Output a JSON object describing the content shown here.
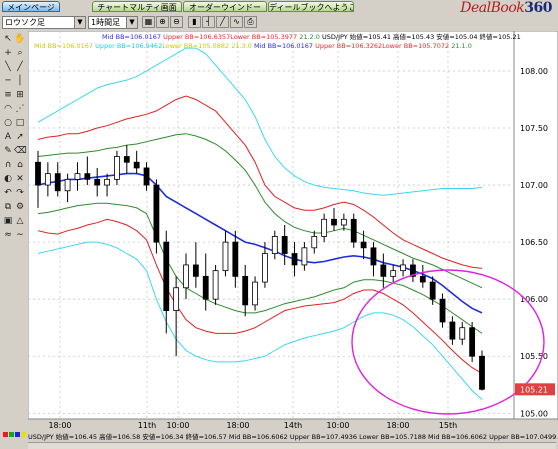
{
  "tabs": [
    {
      "label": "メインページ"
    },
    {
      "label": "チャートマルティ画面"
    },
    {
      "label": "オーダーウインドー"
    },
    {
      "label": "ディールブックへようこそ"
    }
  ],
  "logo": {
    "text": "DealBook",
    "num": "360"
  },
  "toolbar": {
    "chart_type": "ロウソク足",
    "timeframe": "1時間足"
  },
  "legend": {
    "line1": {
      "mid": "Mid BB=106.0167",
      "upper": "Upper BB=106.6357",
      "lower": "Lower BB=105.3977",
      "params": "21.2.0",
      "pair": "USD/JPY 始値=105.41 高値=105.43 安値=105.04 終値=105.21"
    },
    "line2": {
      "mid": "Mid BB=106.0167",
      "upper": "Upper BB=106.9462",
      "lower": "Lower BB=105.0882",
      "params": "21.3.0",
      "mid2": "Mid BB=106.0167",
      "upper2": "Upper BB=106.3262",
      "lower2": "Lower BB=105.7072",
      "params2": "21.1.0"
    }
  },
  "bottom": {
    "text": "USD/JPY 始値=106.45 高値=106.58 安値=106.34 終値=106.57 Mid BB=106.6062 Upper BB=107.4936 Lower BB=105.7188 Mid BB=106.6062 Upper BB=107.0499"
  },
  "colors": {
    "mid": "#1f2fd8",
    "upper1": "#e02020",
    "outer": "#3cd6f0",
    "inner": "#2e8a2e",
    "ellipse": "#e020e0",
    "price_tag": "#e04040"
  },
  "chart_data": {
    "type": "line",
    "price_axis": {
      "min": 105.0,
      "max": 108.0,
      "ticks": [
        "108.00",
        "107.50",
        "107.00",
        "106.50",
        "106.00",
        "105.50",
        "105.00"
      ]
    },
    "time_labels": [
      "18:00",
      "11th",
      "10:00",
      "18:00",
      "14th",
      "10:00",
      "18:00",
      "15th"
    ],
    "current_price": "105.21",
    "grid": true,
    "candles": [
      [
        107.2,
        107.3,
        106.8,
        107.0
      ],
      [
        107.0,
        107.2,
        106.9,
        107.1
      ],
      [
        107.1,
        107.2,
        106.9,
        106.95
      ],
      [
        106.95,
        107.1,
        106.85,
        107.05
      ],
      [
        107.05,
        107.2,
        106.95,
        107.1
      ],
      [
        107.1,
        107.25,
        107.0,
        107.05
      ],
      [
        107.05,
        107.15,
        106.9,
        107.0
      ],
      [
        107.0,
        107.1,
        106.9,
        107.05
      ],
      [
        107.05,
        107.3,
        107.0,
        107.25
      ],
      [
        107.25,
        107.35,
        107.1,
        107.2
      ],
      [
        107.2,
        107.3,
        107.1,
        107.15
      ],
      [
        107.15,
        107.2,
        106.95,
        107.0
      ],
      [
        107.0,
        107.05,
        106.4,
        106.5
      ],
      [
        106.5,
        106.6,
        105.7,
        105.9
      ],
      [
        105.9,
        106.2,
        105.5,
        106.1
      ],
      [
        106.1,
        106.4,
        106.0,
        106.3
      ],
      [
        106.3,
        106.5,
        106.1,
        106.2
      ],
      [
        106.2,
        106.4,
        105.9,
        106.0
      ],
      [
        106.0,
        106.3,
        105.95,
        106.25
      ],
      [
        106.25,
        106.6,
        106.2,
        106.5
      ],
      [
        106.5,
        106.6,
        106.1,
        106.2
      ],
      [
        106.2,
        106.3,
        105.85,
        105.95
      ],
      [
        105.95,
        106.2,
        105.9,
        106.15
      ],
      [
        106.15,
        106.5,
        106.1,
        106.4
      ],
      [
        106.4,
        106.6,
        106.35,
        106.55
      ],
      [
        106.55,
        106.65,
        106.3,
        106.4
      ],
      [
        106.4,
        106.5,
        106.2,
        106.3
      ],
      [
        106.3,
        106.5,
        106.25,
        106.45
      ],
      [
        106.45,
        106.6,
        106.4,
        106.55
      ],
      [
        106.55,
        106.75,
        106.5,
        106.7
      ],
      [
        106.7,
        106.8,
        106.6,
        106.65
      ],
      [
        106.65,
        106.75,
        106.6,
        106.7
      ],
      [
        106.7,
        106.75,
        106.45,
        106.5
      ],
      [
        106.5,
        106.6,
        106.35,
        106.45
      ],
      [
        106.45,
        106.5,
        106.2,
        106.3
      ],
      [
        106.3,
        106.4,
        106.1,
        106.2
      ],
      [
        106.2,
        106.3,
        106.15,
        106.25
      ],
      [
        106.25,
        106.35,
        106.2,
        106.3
      ],
      [
        106.3,
        106.35,
        106.15,
        106.2
      ],
      [
        106.2,
        106.3,
        106.1,
        106.15
      ],
      [
        106.15,
        106.2,
        105.95,
        106.0
      ],
      [
        106.0,
        106.05,
        105.75,
        105.8
      ],
      [
        105.8,
        105.85,
        105.6,
        105.65
      ],
      [
        105.65,
        105.8,
        105.6,
        105.75
      ],
      [
        105.75,
        105.8,
        105.45,
        105.5
      ],
      [
        105.5,
        105.55,
        105.2,
        105.21
      ]
    ],
    "mid_band": [
      107.0,
      107.02,
      107.03,
      107.05,
      107.05,
      107.06,
      107.07,
      107.08,
      107.09,
      107.1,
      107.1,
      107.08,
      107.0,
      106.9,
      106.85,
      106.8,
      106.75,
      106.7,
      106.65,
      106.6,
      106.55,
      106.5,
      106.48,
      106.45,
      106.42,
      106.38,
      106.35,
      106.33,
      106.32,
      106.33,
      106.35,
      106.37,
      106.38,
      106.37,
      106.35,
      106.32,
      106.3,
      106.28,
      106.25,
      106.22,
      106.18,
      106.12,
      106.05,
      105.98,
      105.92,
      105.88
    ],
    "upper_band": [
      107.4,
      107.42,
      107.43,
      107.45,
      107.45,
      107.47,
      107.5,
      107.52,
      107.55,
      107.58,
      107.6,
      107.62,
      107.65,
      107.7,
      107.75,
      107.78,
      107.75,
      107.7,
      107.65,
      107.55,
      107.45,
      107.35,
      107.2,
      107.0,
      106.9,
      106.85,
      106.8,
      106.78,
      106.78,
      106.8,
      106.83,
      106.85,
      106.83,
      106.78,
      106.72,
      106.65,
      106.58,
      106.52,
      106.48,
      106.44,
      106.4,
      106.36,
      106.33,
      106.3,
      106.28,
      106.27
    ],
    "lower_band": [
      106.6,
      106.58,
      106.57,
      106.6,
      106.62,
      106.65,
      106.67,
      106.7,
      106.68,
      106.65,
      106.6,
      106.52,
      106.3,
      106.1,
      105.95,
      105.82,
      105.75,
      105.72,
      105.7,
      105.7,
      105.7,
      105.72,
      105.75,
      105.8,
      105.85,
      105.9,
      105.92,
      105.94,
      105.95,
      105.96,
      105.97,
      106.0,
      106.05,
      106.08,
      106.08,
      106.05,
      106.0,
      105.95,
      105.88,
      105.8,
      105.72,
      105.64,
      105.55,
      105.47,
      105.4,
      105.35
    ],
    "outer_upper": [
      107.55,
      107.6,
      107.65,
      107.7,
      107.75,
      107.8,
      107.85,
      107.88,
      107.9,
      107.92,
      107.95,
      108.0,
      108.05,
      108.1,
      108.15,
      108.2,
      108.2,
      108.15,
      108.05,
      107.95,
      107.85,
      107.75,
      107.6,
      107.4,
      107.25,
      107.15,
      107.08,
      107.03,
      107.0,
      106.98,
      106.97,
      106.96,
      106.95,
      106.93,
      106.92,
      106.91,
      106.92,
      106.93,
      106.94,
      106.95,
      106.96,
      106.97,
      106.97,
      106.97,
      106.97,
      106.98
    ],
    "outer_lower": [
      106.4,
      106.42,
      106.44,
      106.46,
      106.48,
      106.5,
      106.5,
      106.48,
      106.45,
      106.4,
      106.35,
      106.25,
      106.0,
      105.8,
      105.65,
      105.55,
      105.5,
      105.47,
      105.45,
      105.45,
      105.45,
      105.46,
      105.48,
      105.5,
      105.55,
      105.6,
      105.63,
      105.66,
      105.68,
      105.7,
      105.72,
      105.75,
      105.8,
      105.85,
      105.88,
      105.88,
      105.86,
      105.82,
      105.76,
      105.68,
      105.6,
      105.5,
      105.4,
      105.3,
      105.2,
      105.12
    ],
    "inner_upper": [
      107.25,
      107.26,
      107.27,
      107.28,
      107.28,
      107.29,
      107.3,
      107.32,
      107.33,
      107.35,
      107.36,
      107.38,
      107.4,
      107.42,
      107.44,
      107.45,
      107.43,
      107.4,
      107.36,
      107.3,
      107.22,
      107.13,
      107.0,
      106.85,
      106.75,
      106.68,
      106.63,
      106.6,
      106.58,
      106.58,
      106.6,
      106.62,
      106.6,
      106.56,
      106.52,
      106.48,
      106.44,
      106.4,
      106.36,
      106.33,
      106.3,
      106.26,
      106.22,
      106.18,
      106.14,
      106.1
    ],
    "inner_lower": [
      106.75,
      106.76,
      106.78,
      106.8,
      106.82,
      106.83,
      106.84,
      106.84,
      106.83,
      106.82,
      106.8,
      106.75,
      106.55,
      106.35,
      106.2,
      106.1,
      106.05,
      106.0,
      105.96,
      105.93,
      105.9,
      105.88,
      105.88,
      105.9,
      105.93,
      105.96,
      105.98,
      106.0,
      106.02,
      106.05,
      106.08,
      106.1,
      106.15,
      106.17,
      106.17,
      106.16,
      106.14,
      106.12,
      106.08,
      106.04,
      105.99,
      105.94,
      105.88,
      105.82,
      105.76,
      105.7
    ]
  }
}
